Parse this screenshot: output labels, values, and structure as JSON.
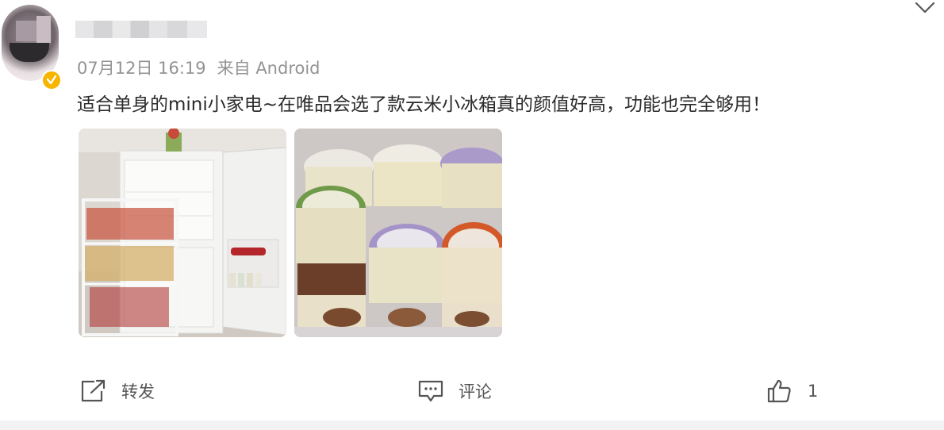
{
  "post": {
    "timestamp": "07月12日 16:19",
    "source": "来自 Android",
    "text": "适合单身的mini小家电~在唯品会选了款云米小冰箱真的颜值好高，功能也完全够用！"
  },
  "actions": {
    "repost_label": "转发",
    "comment_label": "评论",
    "like_count": "1"
  },
  "colors": {
    "verified_badge": "#f7b500",
    "meta_text": "#939393",
    "icon": "#555555"
  },
  "icons": [
    "verified-icon",
    "chevron-down-icon",
    "repost-icon",
    "comment-icon",
    "like-icon"
  ]
}
